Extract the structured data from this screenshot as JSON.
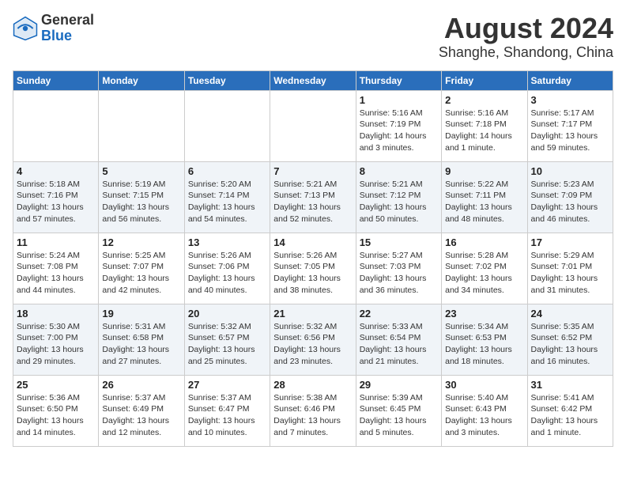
{
  "header": {
    "logo_general": "General",
    "logo_blue": "Blue",
    "title": "August 2024",
    "subtitle": "Shanghe, Shandong, China"
  },
  "weekdays": [
    "Sunday",
    "Monday",
    "Tuesday",
    "Wednesday",
    "Thursday",
    "Friday",
    "Saturday"
  ],
  "weeks": [
    [
      {
        "day": "",
        "detail": ""
      },
      {
        "day": "",
        "detail": ""
      },
      {
        "day": "",
        "detail": ""
      },
      {
        "day": "",
        "detail": ""
      },
      {
        "day": "1",
        "detail": "Sunrise: 5:16 AM\nSunset: 7:19 PM\nDaylight: 14 hours\nand 3 minutes."
      },
      {
        "day": "2",
        "detail": "Sunrise: 5:16 AM\nSunset: 7:18 PM\nDaylight: 14 hours\nand 1 minute."
      },
      {
        "day": "3",
        "detail": "Sunrise: 5:17 AM\nSunset: 7:17 PM\nDaylight: 13 hours\nand 59 minutes."
      }
    ],
    [
      {
        "day": "4",
        "detail": "Sunrise: 5:18 AM\nSunset: 7:16 PM\nDaylight: 13 hours\nand 57 minutes."
      },
      {
        "day": "5",
        "detail": "Sunrise: 5:19 AM\nSunset: 7:15 PM\nDaylight: 13 hours\nand 56 minutes."
      },
      {
        "day": "6",
        "detail": "Sunrise: 5:20 AM\nSunset: 7:14 PM\nDaylight: 13 hours\nand 54 minutes."
      },
      {
        "day": "7",
        "detail": "Sunrise: 5:21 AM\nSunset: 7:13 PM\nDaylight: 13 hours\nand 52 minutes."
      },
      {
        "day": "8",
        "detail": "Sunrise: 5:21 AM\nSunset: 7:12 PM\nDaylight: 13 hours\nand 50 minutes."
      },
      {
        "day": "9",
        "detail": "Sunrise: 5:22 AM\nSunset: 7:11 PM\nDaylight: 13 hours\nand 48 minutes."
      },
      {
        "day": "10",
        "detail": "Sunrise: 5:23 AM\nSunset: 7:09 PM\nDaylight: 13 hours\nand 46 minutes."
      }
    ],
    [
      {
        "day": "11",
        "detail": "Sunrise: 5:24 AM\nSunset: 7:08 PM\nDaylight: 13 hours\nand 44 minutes."
      },
      {
        "day": "12",
        "detail": "Sunrise: 5:25 AM\nSunset: 7:07 PM\nDaylight: 13 hours\nand 42 minutes."
      },
      {
        "day": "13",
        "detail": "Sunrise: 5:26 AM\nSunset: 7:06 PM\nDaylight: 13 hours\nand 40 minutes."
      },
      {
        "day": "14",
        "detail": "Sunrise: 5:26 AM\nSunset: 7:05 PM\nDaylight: 13 hours\nand 38 minutes."
      },
      {
        "day": "15",
        "detail": "Sunrise: 5:27 AM\nSunset: 7:03 PM\nDaylight: 13 hours\nand 36 minutes."
      },
      {
        "day": "16",
        "detail": "Sunrise: 5:28 AM\nSunset: 7:02 PM\nDaylight: 13 hours\nand 34 minutes."
      },
      {
        "day": "17",
        "detail": "Sunrise: 5:29 AM\nSunset: 7:01 PM\nDaylight: 13 hours\nand 31 minutes."
      }
    ],
    [
      {
        "day": "18",
        "detail": "Sunrise: 5:30 AM\nSunset: 7:00 PM\nDaylight: 13 hours\nand 29 minutes."
      },
      {
        "day": "19",
        "detail": "Sunrise: 5:31 AM\nSunset: 6:58 PM\nDaylight: 13 hours\nand 27 minutes."
      },
      {
        "day": "20",
        "detail": "Sunrise: 5:32 AM\nSunset: 6:57 PM\nDaylight: 13 hours\nand 25 minutes."
      },
      {
        "day": "21",
        "detail": "Sunrise: 5:32 AM\nSunset: 6:56 PM\nDaylight: 13 hours\nand 23 minutes."
      },
      {
        "day": "22",
        "detail": "Sunrise: 5:33 AM\nSunset: 6:54 PM\nDaylight: 13 hours\nand 21 minutes."
      },
      {
        "day": "23",
        "detail": "Sunrise: 5:34 AM\nSunset: 6:53 PM\nDaylight: 13 hours\nand 18 minutes."
      },
      {
        "day": "24",
        "detail": "Sunrise: 5:35 AM\nSunset: 6:52 PM\nDaylight: 13 hours\nand 16 minutes."
      }
    ],
    [
      {
        "day": "25",
        "detail": "Sunrise: 5:36 AM\nSunset: 6:50 PM\nDaylight: 13 hours\nand 14 minutes."
      },
      {
        "day": "26",
        "detail": "Sunrise: 5:37 AM\nSunset: 6:49 PM\nDaylight: 13 hours\nand 12 minutes."
      },
      {
        "day": "27",
        "detail": "Sunrise: 5:37 AM\nSunset: 6:47 PM\nDaylight: 13 hours\nand 10 minutes."
      },
      {
        "day": "28",
        "detail": "Sunrise: 5:38 AM\nSunset: 6:46 PM\nDaylight: 13 hours\nand 7 minutes."
      },
      {
        "day": "29",
        "detail": "Sunrise: 5:39 AM\nSunset: 6:45 PM\nDaylight: 13 hours\nand 5 minutes."
      },
      {
        "day": "30",
        "detail": "Sunrise: 5:40 AM\nSunset: 6:43 PM\nDaylight: 13 hours\nand 3 minutes."
      },
      {
        "day": "31",
        "detail": "Sunrise: 5:41 AM\nSunset: 6:42 PM\nDaylight: 13 hours\nand 1 minute."
      }
    ]
  ]
}
